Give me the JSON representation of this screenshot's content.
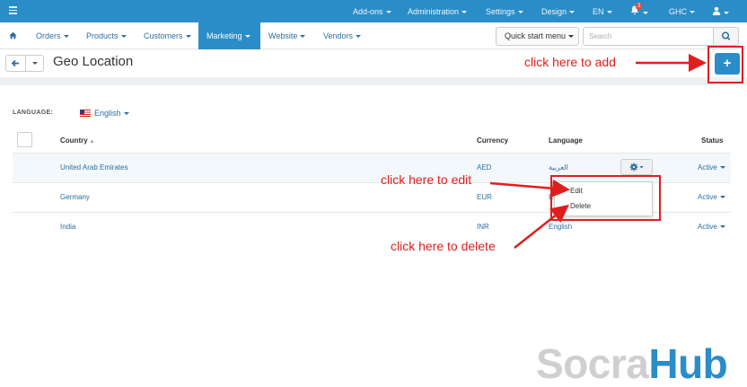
{
  "topbar": {
    "addons": "Add-ons",
    "administration": "Administration",
    "settings": "Settings",
    "design": "Design",
    "language": "EN",
    "notifications_count": "3",
    "currency": "GHC"
  },
  "navbar": {
    "orders": "Orders",
    "products": "Products",
    "customers": "Customers",
    "marketing": "Marketing",
    "website": "Website",
    "vendors": "Vendors",
    "quick_start": "Quick start menu",
    "search_placeholder": "Search"
  },
  "page": {
    "title": "Geo Location",
    "add_label": "+"
  },
  "filter": {
    "label": "LANGUAGE:",
    "value": "English"
  },
  "table": {
    "headers": {
      "country": "Country",
      "currency": "Currency",
      "language": "Language",
      "status": "Status"
    },
    "rows": [
      {
        "country": "United Arab Emirates",
        "currency": "AED",
        "language": "العربية",
        "status": "Active"
      },
      {
        "country": "Germany",
        "currency": "EUR",
        "language": "En",
        "status": "Active"
      },
      {
        "country": "India",
        "currency": "INR",
        "language": "English",
        "status": "Active"
      }
    ]
  },
  "dropdown": {
    "edit": "Edit",
    "delete": "Delete"
  },
  "annotations": {
    "add": "click here to add",
    "edit": "click here to edit",
    "delete": "click here to delete"
  },
  "watermark": {
    "part1": "Socra",
    "part2": "Hub"
  },
  "colors": {
    "accent": "#2b8dc7",
    "annotation": "#e01e1e",
    "link": "#2b6f9e"
  }
}
